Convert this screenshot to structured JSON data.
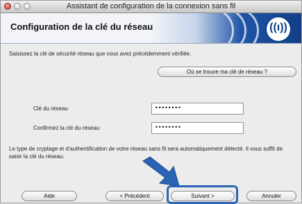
{
  "window": {
    "title": "Assistant de configuration de la connexion sans fil"
  },
  "banner": {
    "title": "Configuration de la clé du réseau",
    "logo_icon": "wifi-radio-icon"
  },
  "main": {
    "instruction": "Saisissez la clé de sécurité réseau que vous avez précédemment vérifiée.",
    "help_button": "Où se trouve ma clé de réseau ?",
    "fields": [
      {
        "label": "Clé du réseau",
        "value": "••••••••"
      },
      {
        "label": "Confirmez la clé du réseau",
        "value": "••••••••"
      }
    ],
    "note": "Le type de cryptage et d'authentification de votre réseau sans fil sera automatiquement détecté. Il vous suffit de saisir la clé du réseau."
  },
  "footer": {
    "help": "Aide",
    "previous": "< Précédent",
    "next": "Suivant >",
    "cancel": "Annuler"
  },
  "colors": {
    "accent": "#2a63b4",
    "banner_blue": "#1f55a6"
  }
}
